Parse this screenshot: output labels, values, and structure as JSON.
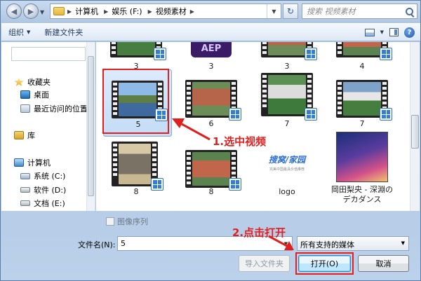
{
  "address": {
    "crumbs": [
      "计算机",
      "娱乐 (F:)",
      "视频素材"
    ],
    "search_placeholder": "搜索 视频素材"
  },
  "toolbar": {
    "organize": "组织",
    "new_folder": "新建文件夹"
  },
  "nav": {
    "favorites": "收藏夹",
    "desktop": "桌面",
    "recent": "最近访问的位置",
    "library": "库",
    "computer": "计算机",
    "drives": [
      "系统 (C:)",
      "软件 (D:)",
      "文档 (E:)"
    ]
  },
  "files": {
    "row0": [
      "3",
      "3",
      "3",
      "4"
    ],
    "row1": [
      "5",
      "6",
      "7",
      "7"
    ],
    "aep_text": "AEP",
    "logo_brand": "搜窝/家园",
    "logo_sub": "完美中国最具价值推荐",
    "row2": [
      "8",
      "8",
      "logo",
      "岡田梨央 - 深淵のデカダンス"
    ]
  },
  "bottom": {
    "image_sequence": "图像序列",
    "filename_label": "文件名(N):",
    "filename_value": "5",
    "filter_value": "所有支持的媒体",
    "import_folder": "导入文件夹",
    "open": "打开(O)",
    "cancel": "取消"
  },
  "annotations": {
    "step1": "1.选中视频",
    "step2": "2.点击打开",
    "color": "#e0201e"
  }
}
